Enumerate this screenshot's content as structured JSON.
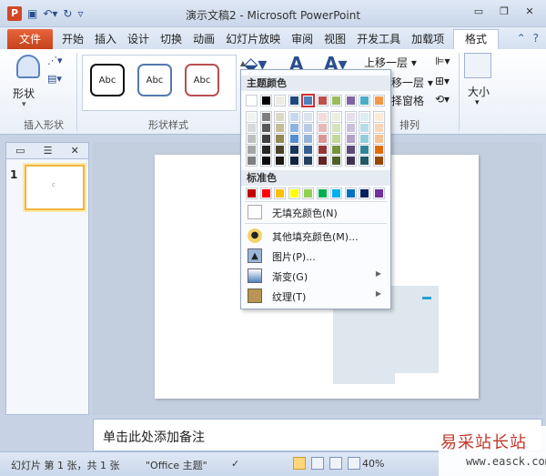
{
  "titlebar": {
    "app_icon": "P",
    "title": "演示文稿2 - Microsoft PowerPoint",
    "qat_icons": [
      "save-icon",
      "undo-icon",
      "redo-icon",
      "customize-icon"
    ],
    "window_controls": [
      "minimize-icon",
      "restore-icon",
      "close-icon"
    ]
  },
  "tabs": {
    "file": "文件",
    "items": [
      "开始",
      "插入",
      "设计",
      "切换",
      "动画",
      "幻灯片放映",
      "审阅",
      "视图",
      "开发工具",
      "加载项"
    ],
    "active": "格式"
  },
  "ribbon": {
    "insert_shapes_label": "形状",
    "insert_shapes_group": "插入形状",
    "shape_styles_group": "形状样式",
    "gallery_items": [
      "Abc",
      "Abc",
      "Abc"
    ],
    "arrange_group": "排列",
    "bring_forward": "上移一层",
    "send_backward": "移一层",
    "selection_pane": "择窗格",
    "size_label": "大小"
  },
  "palette": {
    "theme_colors_header": "主题颜色",
    "standard_colors_header": "标准色",
    "theme_top_row": [
      "#ffffff",
      "#000000",
      "#eeece1",
      "#1f497d",
      "#4f81bd",
      "#c0504d",
      "#9bbb59",
      "#8064a2",
      "#4bacc6",
      "#f79646"
    ],
    "theme_shades": [
      [
        "#f2f2f2",
        "#7f7f7f",
        "#ddd9c3",
        "#c6d9f0",
        "#dbe5f1",
        "#f2dcdb",
        "#ebf1dd",
        "#e5e0ec",
        "#dbeef3",
        "#fdeada"
      ],
      [
        "#d8d8d8",
        "#595959",
        "#c4bd97",
        "#8db3e2",
        "#b8cce4",
        "#e5b9b7",
        "#d7e3bc",
        "#ccc1d9",
        "#b7dde8",
        "#fbd5b5"
      ],
      [
        "#bfbfbf",
        "#3f3f3f",
        "#938953",
        "#548dd4",
        "#95b3d7",
        "#d99694",
        "#c3d69b",
        "#b2a2c7",
        "#92cddc",
        "#fac08f"
      ],
      [
        "#a5a5a5",
        "#262626",
        "#494429",
        "#17365d",
        "#366092",
        "#953734",
        "#76923c",
        "#5f497a",
        "#31859b",
        "#e36c09"
      ],
      [
        "#7f7f7f",
        "#0c0c0c",
        "#1d1b10",
        "#0f243e",
        "#244061",
        "#632423",
        "#4f6128",
        "#3f3151",
        "#205867",
        "#974806"
      ]
    ],
    "selected_index": 4,
    "standard_colors": [
      "#c00000",
      "#ff0000",
      "#ffc000",
      "#ffff00",
      "#92d050",
      "#00b050",
      "#00b0f0",
      "#0070c0",
      "#002060",
      "#7030a0"
    ],
    "no_fill": "无填充颜色(N)",
    "more_colors": "其他填充颜色(M)...",
    "picture": "图片(P)...",
    "gradient": "渐变(G)",
    "texture": "纹理(T)"
  },
  "slides": {
    "number": "1",
    "thumb_mark": "c"
  },
  "notes": {
    "placeholder": "单击此处添加备注"
  },
  "status": {
    "slide_info": "幻灯片 第 1 张，共 1 张",
    "theme": "\"Office 主题\"",
    "zoom": "40%"
  },
  "watermark": {
    "brand": "易采站长站",
    "url": "www.easck.com"
  }
}
